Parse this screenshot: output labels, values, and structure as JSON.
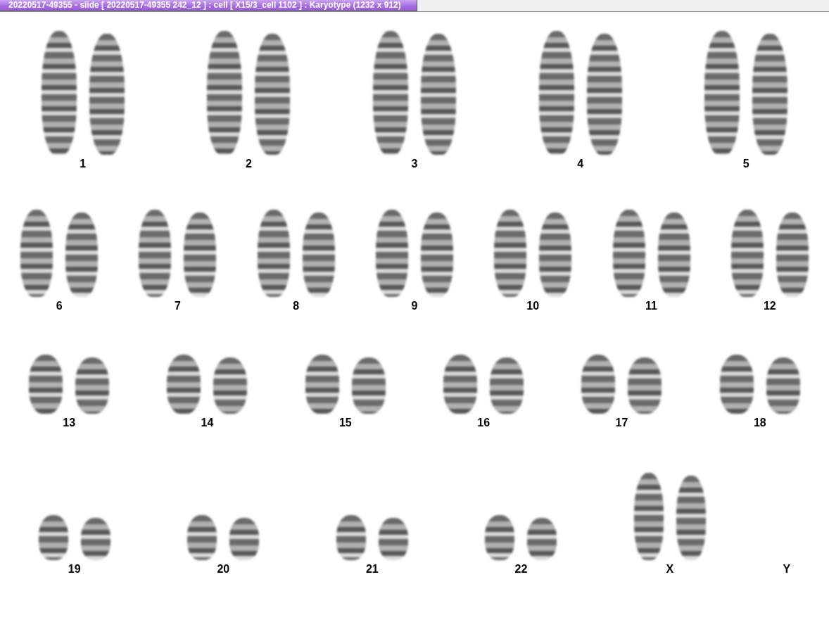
{
  "window": {
    "title": "20220517-49355 - slide [ 20220517-49355 242_12 ] : cell [ X15/3_cell 1102 ] : Karyotype  (1232 x 912)"
  },
  "karyotype": {
    "rows": [
      {
        "pairs": [
          {
            "label": "1",
            "kind": "pair"
          },
          {
            "label": "2",
            "kind": "pair"
          },
          {
            "label": "3",
            "kind": "pair"
          },
          {
            "label": "4",
            "kind": "pair"
          },
          {
            "label": "5",
            "kind": "pair"
          }
        ]
      },
      {
        "pairs": [
          {
            "label": "6",
            "kind": "pair"
          },
          {
            "label": "7",
            "kind": "pair"
          },
          {
            "label": "8",
            "kind": "pair"
          },
          {
            "label": "9",
            "kind": "pair"
          },
          {
            "label": "10",
            "kind": "pair"
          },
          {
            "label": "11",
            "kind": "pair"
          },
          {
            "label": "12",
            "kind": "pair"
          }
        ]
      },
      {
        "pairs": [
          {
            "label": "13",
            "kind": "pair"
          },
          {
            "label": "14",
            "kind": "pair"
          },
          {
            "label": "15",
            "kind": "pair"
          },
          {
            "label": "16",
            "kind": "pair"
          },
          {
            "label": "17",
            "kind": "pair"
          },
          {
            "label": "18",
            "kind": "pair"
          }
        ]
      },
      {
        "pairs": [
          {
            "label": "19",
            "kind": "pair"
          },
          {
            "label": "20",
            "kind": "pair"
          },
          {
            "label": "21",
            "kind": "pair"
          },
          {
            "label": "22",
            "kind": "pair"
          },
          {
            "label": "X",
            "kind": "tall"
          },
          {
            "label": "Y",
            "kind": "empty"
          }
        ]
      }
    ]
  }
}
